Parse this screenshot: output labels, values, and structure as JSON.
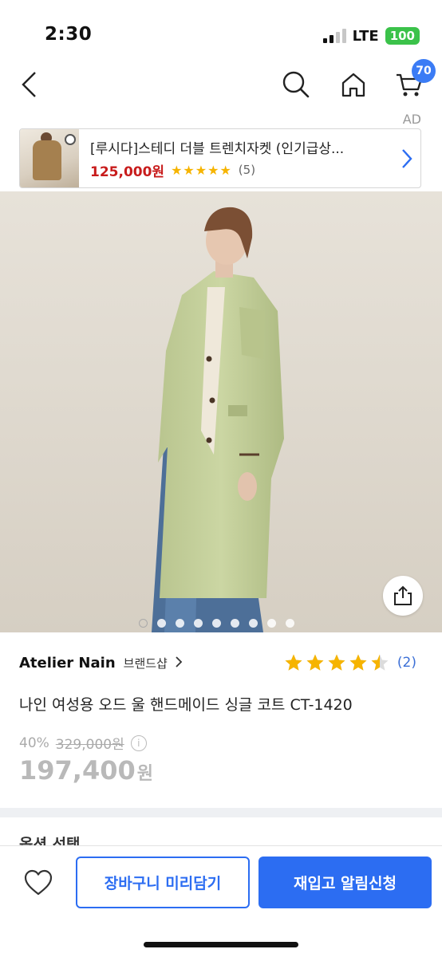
{
  "status_bar": {
    "time": "2:30",
    "network": "LTE",
    "battery": "100"
  },
  "nav": {
    "cart_count": "70"
  },
  "ad": {
    "label": "AD",
    "title": "[루시다]스테디 더블 트렌치자켓 (인기급상...",
    "price": "125,000원",
    "stars": "★★★★★",
    "review_count": "(5)"
  },
  "gallery": {
    "image_count": 9,
    "current_index": 1
  },
  "product": {
    "brand": "Atelier Nain",
    "brand_shop_link": "브랜드샵",
    "rating": 4.5,
    "review_count": "(2)",
    "name": "나인 여성용 오드 울 핸드메이드 싱글 코트 CT-1420",
    "discount": "40%",
    "original_price": "329,000원",
    "price": "197,400",
    "price_unit": "원"
  },
  "section_peek": "옵션 선택",
  "bottom_bar": {
    "cart_button": "장바구니 미리담기",
    "notify_button": "재입고 알림신청"
  },
  "colors": {
    "accent": "#2c6df2",
    "sale_red": "#c81c1c",
    "star": "#f6b400",
    "badge": "#3b7cf5"
  }
}
